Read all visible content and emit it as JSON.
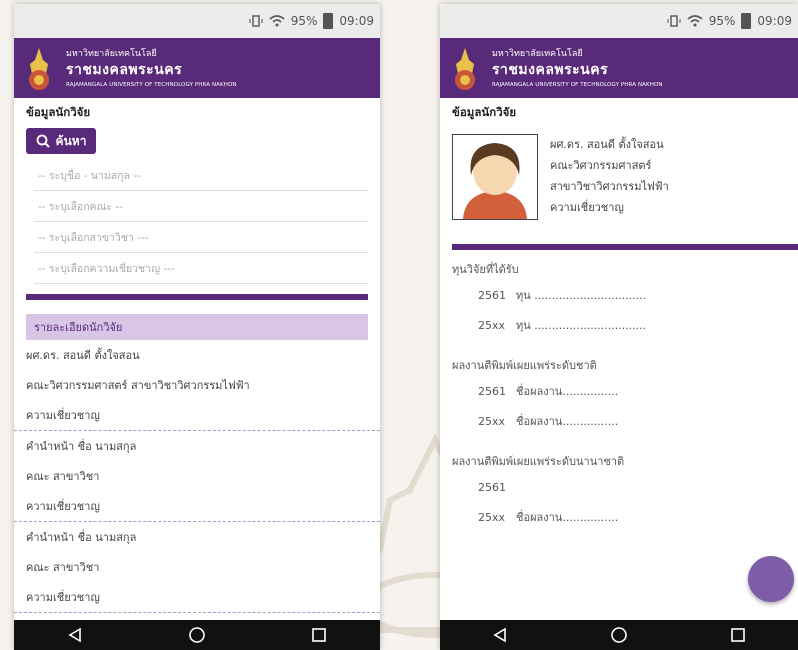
{
  "status": {
    "battery": "95%",
    "time": "09:09"
  },
  "header": {
    "line1": "มหาวิทยาลัยเทคโนโลยี",
    "line2": "ราชมงคลพระนคร",
    "line3": "RAJAMANGALA UNIVERSITY OF TECHNOLOGY PHRA NAKHON"
  },
  "left": {
    "section_title": "ข้อมูลนักวิจัย",
    "search_label": "ค้นหา",
    "fields": [
      "-- ระบุชื่อ - นามสกุล --",
      "-- ระบุเลือกคณะ --",
      "-- ระบุเลือกสาขาวิชา ---",
      "-- ระบุเลือกความเชี่ยวชาญ ---"
    ],
    "detail_header": "รายละเอียดนักวิจัย",
    "rows": [
      "ผศ.ดร. สอนดี ตั้งใจสอน",
      "คณะวิศวกรรมศาสตร์ สาขาวิชาวิศวกรรมไฟฟ้า",
      "ความเชี่ยวชาญ",
      "คำนำหน้า ชื่อ นามสกุล",
      "คณะ สาขาวิชา",
      "ความเชี่ยวชาญ",
      "คำนำหน้า ชื่อ นามสกุล",
      "คณะ สาขาวิชา",
      "ความเชี่ยวชาญ"
    ]
  },
  "right": {
    "section_title": "ข้อมูลนักวิจัย",
    "profile": {
      "name": "ผศ.ดร. สอนดี ตั้งใจสอน",
      "faculty": "คณะวิศวกรรมศาสตร์",
      "major": "สาขาวิชาวิศวกรรมไฟฟ้า",
      "expertise": "ความเชี่ยวชาญ"
    },
    "grants_title": "ทุนวิจัยที่ได้รับ",
    "grants": [
      {
        "year": "2561",
        "text": "ทุน ................................"
      },
      {
        "year": "25xx",
        "text": "ทุน ................................"
      }
    ],
    "national_title": "ผลงานตีพิมพ์เผยแพร่ระดับชาติ",
    "national": [
      {
        "year": "2561",
        "text": "ชื่อผลงาน................"
      },
      {
        "year": "25xx",
        "text": "ชื่อผลงาน................"
      }
    ],
    "international_title": "ผลงานตีพิมพ์เผยแพร่ระดับนานาชาติ",
    "international": [
      {
        "year": "2561",
        "text": ""
      },
      {
        "year": "25xx",
        "text": "ชื่อผลงาน................"
      }
    ]
  },
  "colors": {
    "brand": "#5a2a7a",
    "subhead": "#d9c6e7",
    "fab": "#7d5da8"
  },
  "icons": [
    "vibrate-icon",
    "wifi-icon",
    "battery-icon",
    "search-icon",
    "back-icon",
    "home-icon",
    "recents-icon"
  ]
}
